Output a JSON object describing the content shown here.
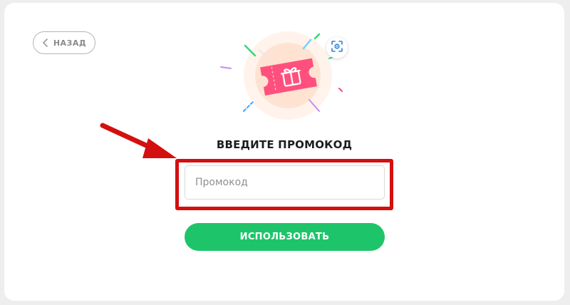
{
  "back_button": {
    "label": "НАЗАД"
  },
  "promo": {
    "title": "ВВЕДИТЕ ПРОМОКОД",
    "placeholder": "Промокод",
    "value": ""
  },
  "use_button": {
    "label": "ИСПОЛЬЗОВАТЬ"
  },
  "icons": {
    "back": "chevron-left-icon",
    "scan": "scan-qr-icon",
    "illustration": "gift-ticket-icon",
    "annotation": "red-arrow"
  },
  "colors": {
    "accent_green": "#1ec46a",
    "highlight_red": "#d40f0f",
    "ticket_pink": "#ff3aa0",
    "ticket_glow": "#ffe3d2"
  }
}
